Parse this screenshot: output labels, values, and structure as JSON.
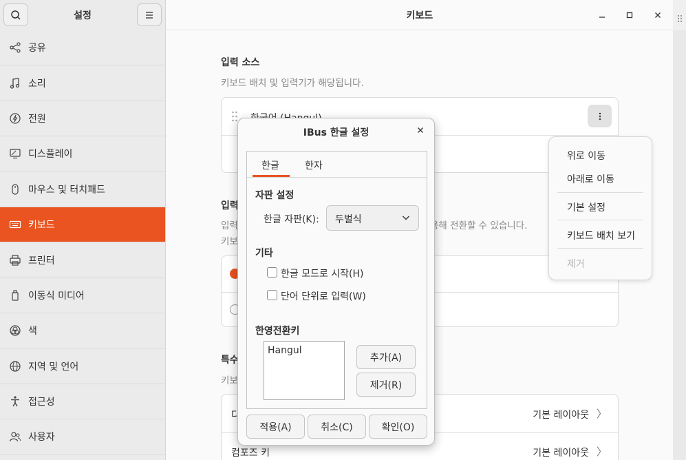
{
  "sidebar": {
    "title": "설정",
    "items": [
      {
        "label": "공유",
        "icon": "share-icon"
      },
      {
        "label": "소리",
        "icon": "music-note-icon"
      },
      {
        "label": "전원",
        "icon": "power-icon"
      },
      {
        "label": "디스플레이",
        "icon": "display-icon"
      },
      {
        "label": "마우스 및 터치패드",
        "icon": "mouse-icon"
      },
      {
        "label": "키보드",
        "icon": "keyboard-icon",
        "active": true
      },
      {
        "label": "프린터",
        "icon": "printer-icon"
      },
      {
        "label": "이동식 미디어",
        "icon": "removable-media-icon"
      },
      {
        "label": "색",
        "icon": "color-icon"
      },
      {
        "label": "지역 및 언어",
        "icon": "globe-icon"
      },
      {
        "label": "접근성",
        "icon": "accessibility-icon"
      },
      {
        "label": "사용자",
        "icon": "users-icon"
      }
    ]
  },
  "main": {
    "title": "키보드",
    "input_sources": {
      "title": "입력 소스",
      "subtitle": "키보드 배치 및 입력기가 해당됩니다.",
      "first_source": "한국어 (Hangul)"
    },
    "switching": {
      "title_fragment": "입력",
      "desc_fragment_left": "입력",
      "desc_fragment_right": "용해 전환할 수 있습니다.",
      "desc2_fragment": "키보"
    },
    "special": {
      "title_fragment": "특수",
      "sub_fragment": "키보",
      "rows": [
        {
          "label": "다",
          "value": "기본 레이아웃"
        },
        {
          "label": "컴포즈 키",
          "value": "기본 레이아웃"
        }
      ]
    }
  },
  "popover": {
    "items": [
      "위로 이동",
      "아래로 이동",
      "기본 설정",
      "키보드 배치 보기",
      "제거"
    ]
  },
  "dialog": {
    "title": "IBus 한글 설정",
    "tabs": [
      "한글",
      "한자"
    ],
    "layout_heading": "자판 설정",
    "layout_label": "한글 자판(K):",
    "layout_value": "두벌식",
    "etc_heading": "기타",
    "check1": "한글 모드로 시작(H)",
    "check2": "단어 단위로 입력(W)",
    "toggle_heading": "한영전환키",
    "toggle_keys": [
      "Hangul"
    ],
    "add_button": "추가(A)",
    "remove_button": "제거(R)",
    "apply_button": "적용(A)",
    "cancel_button": "취소(C)",
    "ok_button": "확인(O)"
  },
  "colors": {
    "accent": "#e95420"
  }
}
